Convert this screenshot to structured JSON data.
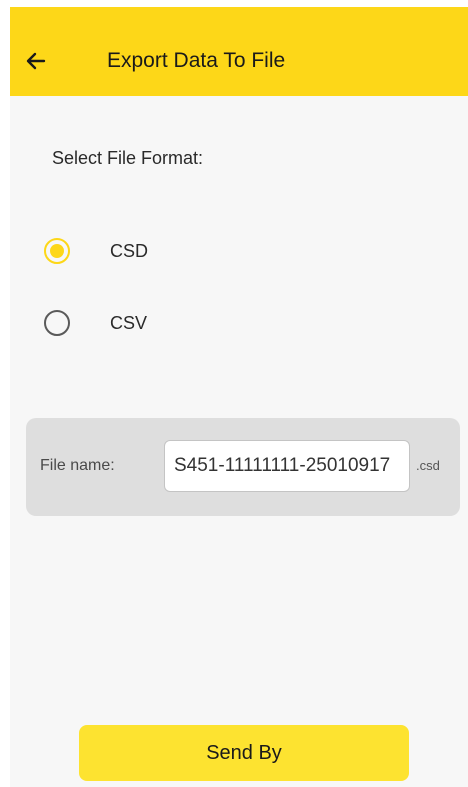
{
  "appbar": {
    "title": "Export Data To File",
    "back_icon": "arrow-left-icon"
  },
  "format_section": {
    "label": "Select File Format:",
    "options": [
      {
        "label": "CSD",
        "selected": true
      },
      {
        "label": "CSV",
        "selected": false
      }
    ]
  },
  "file": {
    "label": "File name:",
    "value": "S451-11111111-25010917",
    "extension": ".csd"
  },
  "actions": {
    "send_label": "Send By"
  },
  "colors": {
    "accent": "#fdd718",
    "button": "#fde330",
    "panel": "#dedede",
    "background": "#f7f7f7"
  }
}
